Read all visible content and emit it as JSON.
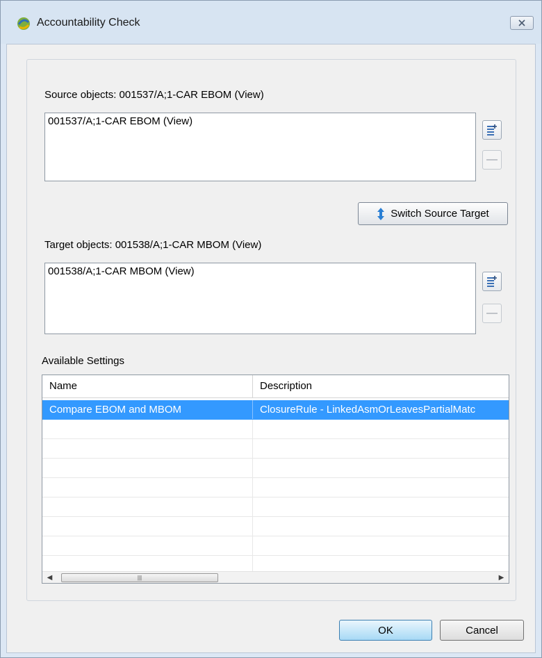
{
  "window": {
    "title": "Accountability Check"
  },
  "source": {
    "label": "Source objects: 001537/A;1-CAR EBOM (View)",
    "items": [
      "001537/A;1-CAR EBOM (View)"
    ]
  },
  "switch_button": {
    "label": "Switch Source Target"
  },
  "target": {
    "label": "Target objects: 001538/A;1-CAR MBOM (View)",
    "items": [
      "001538/A;1-CAR MBOM (View)"
    ]
  },
  "settings": {
    "label": "Available Settings",
    "columns": [
      "Name",
      "Description"
    ],
    "rows": [
      {
        "name": "Compare EBOM and MBOM",
        "description": "ClosureRule - LinkedAsmOrLeavesPartialMatc",
        "selected": true
      }
    ]
  },
  "buttons": {
    "ok": "OK",
    "cancel": "Cancel"
  },
  "colors": {
    "selection": "#3399ff",
    "background": "#f0f0f0",
    "frame": "#dce7f4"
  },
  "icons": {
    "add": "add-list-icon",
    "remove": "remove-icon",
    "switch": "switch-arrows-icon",
    "app": "app-logo-icon",
    "close": "close-icon"
  }
}
